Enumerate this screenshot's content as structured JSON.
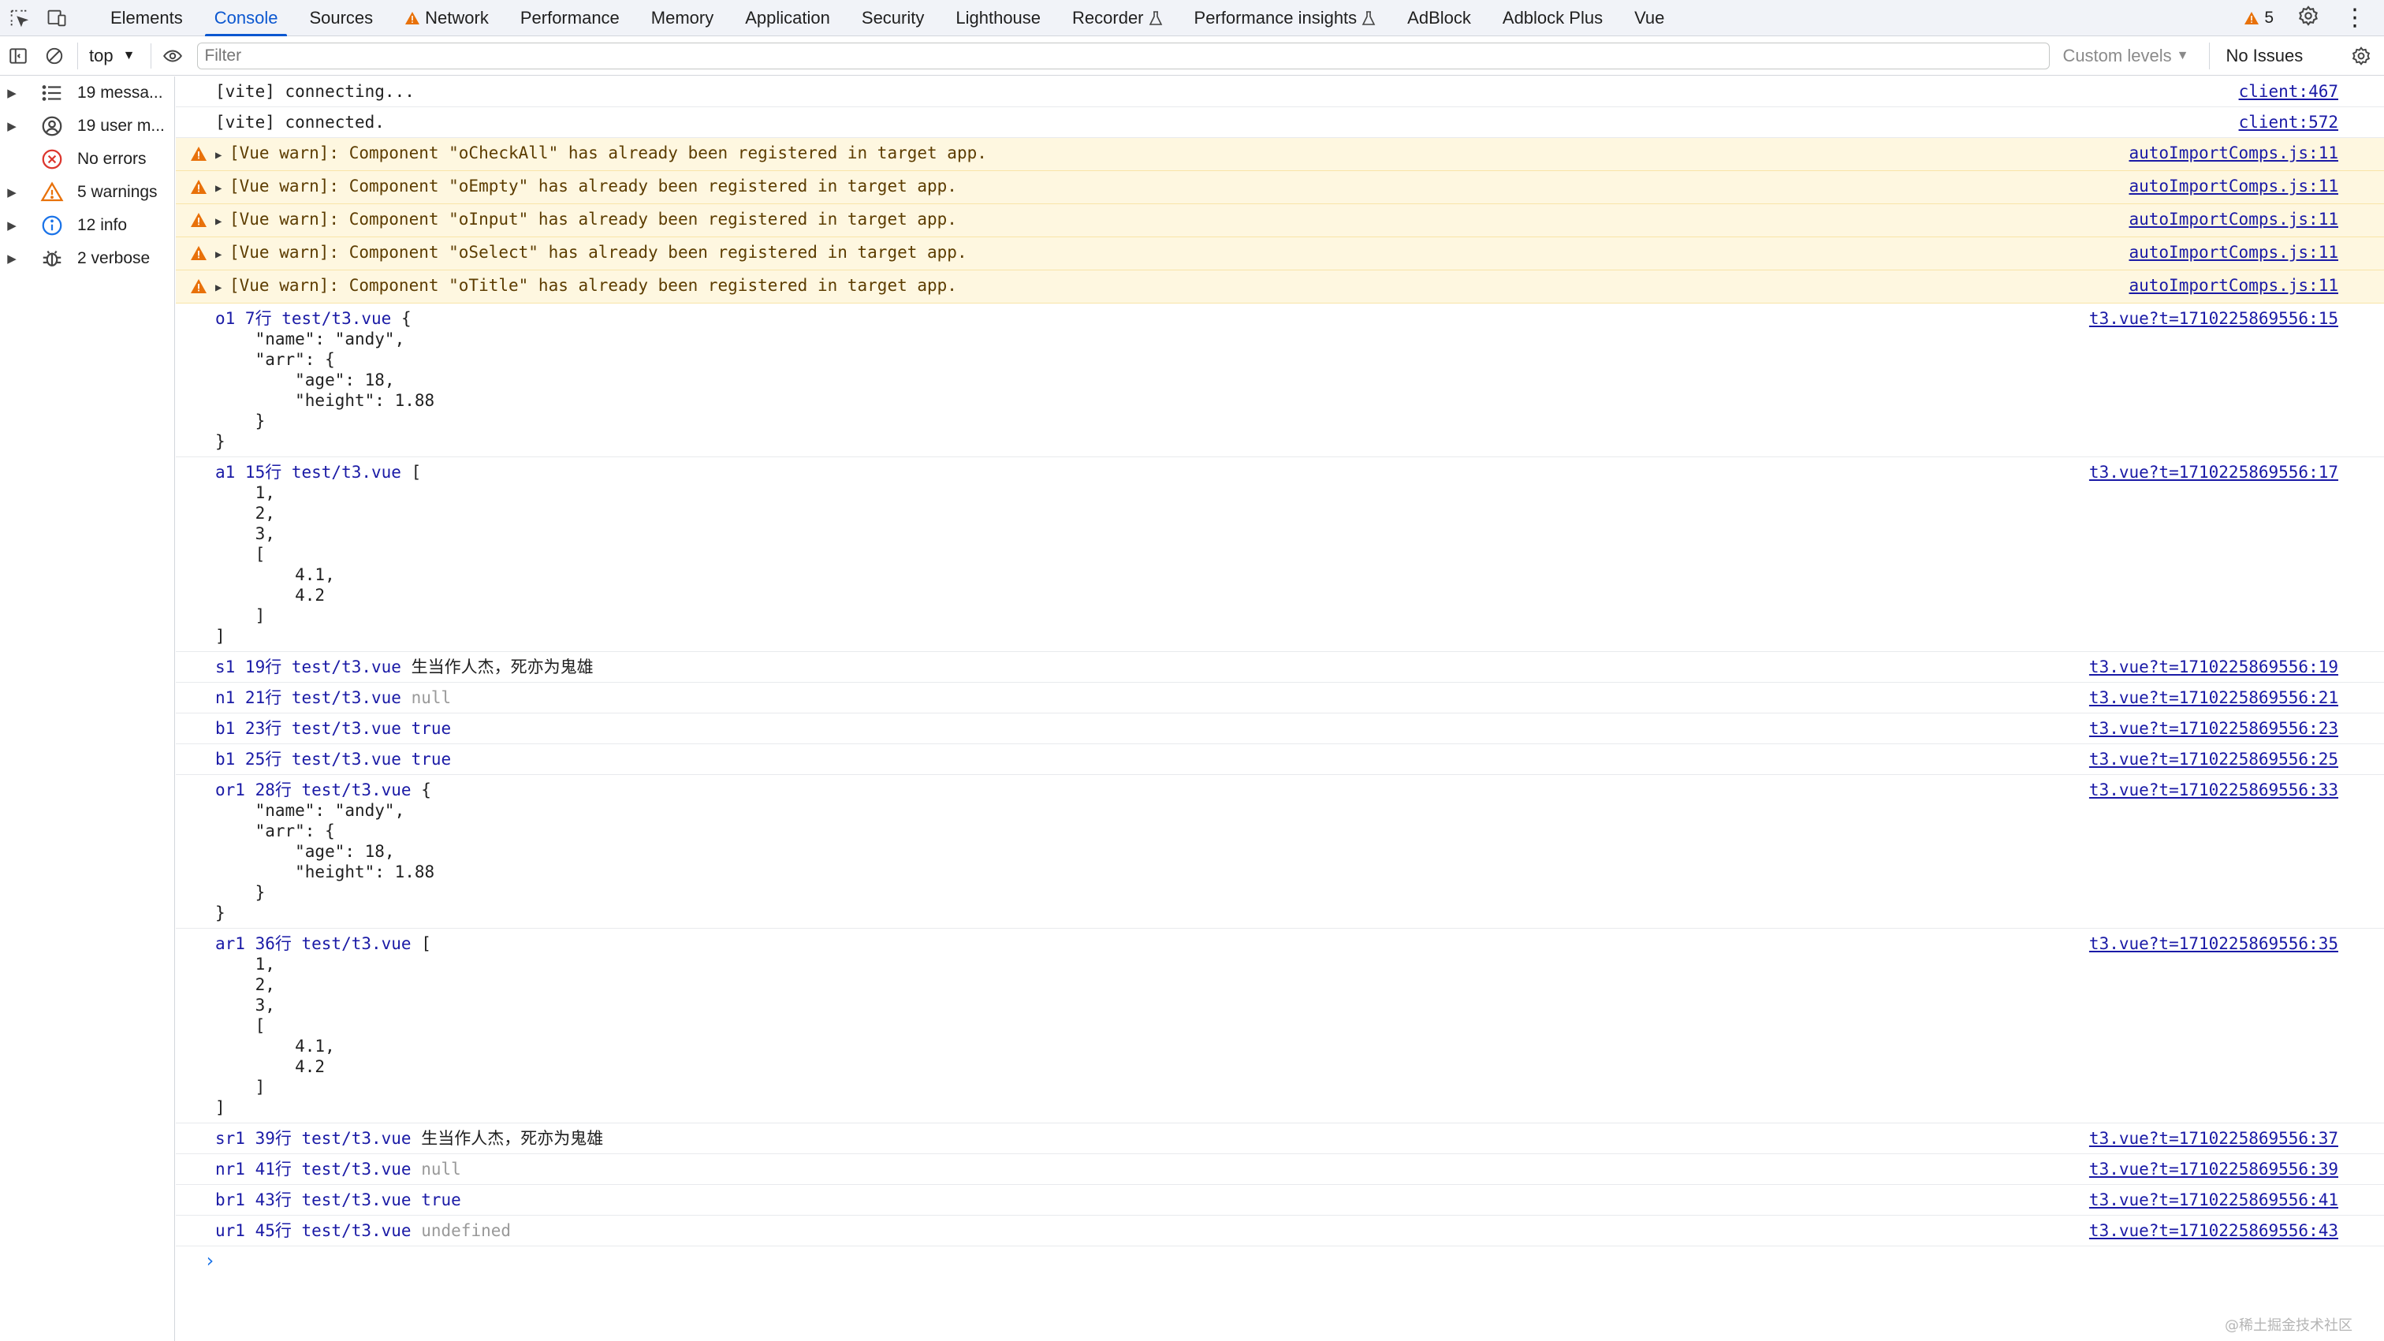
{
  "tabbar": {
    "tabs": [
      {
        "label": "Elements",
        "warn": false,
        "flask": false,
        "active": false
      },
      {
        "label": "Console",
        "warn": false,
        "flask": false,
        "active": true
      },
      {
        "label": "Sources",
        "warn": false,
        "flask": false,
        "active": false
      },
      {
        "label": "Network",
        "warn": true,
        "flask": false,
        "active": false
      },
      {
        "label": "Performance",
        "warn": false,
        "flask": false,
        "active": false
      },
      {
        "label": "Memory",
        "warn": false,
        "flask": false,
        "active": false
      },
      {
        "label": "Application",
        "warn": false,
        "flask": false,
        "active": false
      },
      {
        "label": "Security",
        "warn": false,
        "flask": false,
        "active": false
      },
      {
        "label": "Lighthouse",
        "warn": false,
        "flask": false,
        "active": false
      },
      {
        "label": "Recorder",
        "warn": false,
        "flask": true,
        "active": false
      },
      {
        "label": "Performance insights",
        "warn": false,
        "flask": true,
        "active": false
      },
      {
        "label": "AdBlock",
        "warn": false,
        "flask": false,
        "active": false
      },
      {
        "label": "Adblock Plus",
        "warn": false,
        "flask": false,
        "active": false
      },
      {
        "label": "Vue",
        "warn": false,
        "flask": false,
        "active": false
      }
    ],
    "issue_count": "5",
    "icons": {
      "inspect": "inspect-element-icon",
      "device": "device-toolbar-icon",
      "settings": "gear-icon",
      "more": "more-vertical-icon"
    }
  },
  "toolbar": {
    "context": "top",
    "filter_placeholder": "Filter",
    "levels": "Custom levels",
    "issues": "No Issues"
  },
  "sidebar": {
    "items": [
      {
        "label": "19 messa...",
        "icon": "list-icon",
        "expandable": true
      },
      {
        "label": "19 user m...",
        "icon": "user-icon",
        "expandable": true
      },
      {
        "label": "No errors",
        "icon": "error-icon",
        "expandable": false
      },
      {
        "label": "5 warnings",
        "icon": "warning-icon",
        "expandable": true
      },
      {
        "label": "12 info",
        "icon": "info-icon",
        "expandable": true
      },
      {
        "label": "2 verbose",
        "icon": "bug-icon",
        "expandable": true
      }
    ]
  },
  "console": {
    "messages": [
      {
        "type": "log",
        "text": "[vite] connecting...",
        "source": "client:467"
      },
      {
        "type": "log",
        "text": "[vite] connected.",
        "source": "client:572"
      },
      {
        "type": "warn",
        "text": "[Vue warn]: Component \"oCheckAll\" has already been registered in target app.",
        "source": "autoImportComps.js:11"
      },
      {
        "type": "warn",
        "text": "[Vue warn]: Component \"oEmpty\" has already been registered in target app.",
        "source": "autoImportComps.js:11"
      },
      {
        "type": "warn",
        "text": "[Vue warn]: Component \"oInput\" has already been registered in target app.",
        "source": "autoImportComps.js:11"
      },
      {
        "type": "warn",
        "text": "[Vue warn]: Component \"oSelect\" has already been registered in target app.",
        "source": "autoImportComps.js:11"
      },
      {
        "type": "warn",
        "text": "[Vue warn]: Component \"oTitle\" has already been registered in target app.",
        "source": "autoImportComps.js:11"
      },
      {
        "type": "obj",
        "prefix": "o1 7行 test/t3.vue",
        "body": " {\n    \"name\": \"andy\",\n    \"arr\": {\n        \"age\": 18,\n        \"height\": 1.88\n    }\n}",
        "source": "t3.vue?t=1710225869556:15"
      },
      {
        "type": "obj",
        "prefix": "a1 15行 test/t3.vue",
        "body": " [\n    1,\n    2,\n    3,\n    [\n        4.1,\n        4.2\n    ]\n]",
        "source": "t3.vue?t=1710225869556:17"
      },
      {
        "type": "val",
        "prefix": "s1 19行 test/t3.vue",
        "value": "生当作人杰，死亦为鬼雄",
        "vclass": "strtxt",
        "source": "t3.vue?t=1710225869556:19"
      },
      {
        "type": "val",
        "prefix": "n1 21行 test/t3.vue",
        "value": "null",
        "vclass": "gray",
        "source": "t3.vue?t=1710225869556:21"
      },
      {
        "type": "val",
        "prefix": "b1 23行 test/t3.vue",
        "value": "true",
        "vclass": "boolv",
        "source": "t3.vue?t=1710225869556:23"
      },
      {
        "type": "val",
        "prefix": "b1 25行 test/t3.vue",
        "value": "true",
        "vclass": "boolv",
        "source": "t3.vue?t=1710225869556:25"
      },
      {
        "type": "obj",
        "prefix": "or1 28行 test/t3.vue",
        "body": " {\n    \"name\": \"andy\",\n    \"arr\": {\n        \"age\": 18,\n        \"height\": 1.88\n    }\n}",
        "source": "t3.vue?t=1710225869556:33"
      },
      {
        "type": "obj",
        "prefix": "ar1 36行 test/t3.vue",
        "body": " [\n    1,\n    2,\n    3,\n    [\n        4.1,\n        4.2\n    ]\n]",
        "source": "t3.vue?t=1710225869556:35"
      },
      {
        "type": "val",
        "prefix": "sr1 39行 test/t3.vue",
        "value": "生当作人杰，死亦为鬼雄",
        "vclass": "strtxt",
        "source": "t3.vue?t=1710225869556:37"
      },
      {
        "type": "val",
        "prefix": "nr1 41行 test/t3.vue",
        "value": "null",
        "vclass": "gray",
        "source": "t3.vue?t=1710225869556:39"
      },
      {
        "type": "val",
        "prefix": "br1 43行 test/t3.vue",
        "value": "true",
        "vclass": "boolv",
        "source": "t3.vue?t=1710225869556:41"
      },
      {
        "type": "val",
        "prefix": "ur1 45行 test/t3.vue",
        "value": "undefined",
        "vclass": "gray",
        "source": "t3.vue?t=1710225869556:43"
      }
    ],
    "prompt": "›"
  },
  "watermark": "@稀土掘金技术社区",
  "colors": {
    "accent": "#0b57d0",
    "warning": "#e8710a",
    "error": "#dc362e",
    "info": "#1a73e8",
    "link": "#1a1aa6"
  }
}
